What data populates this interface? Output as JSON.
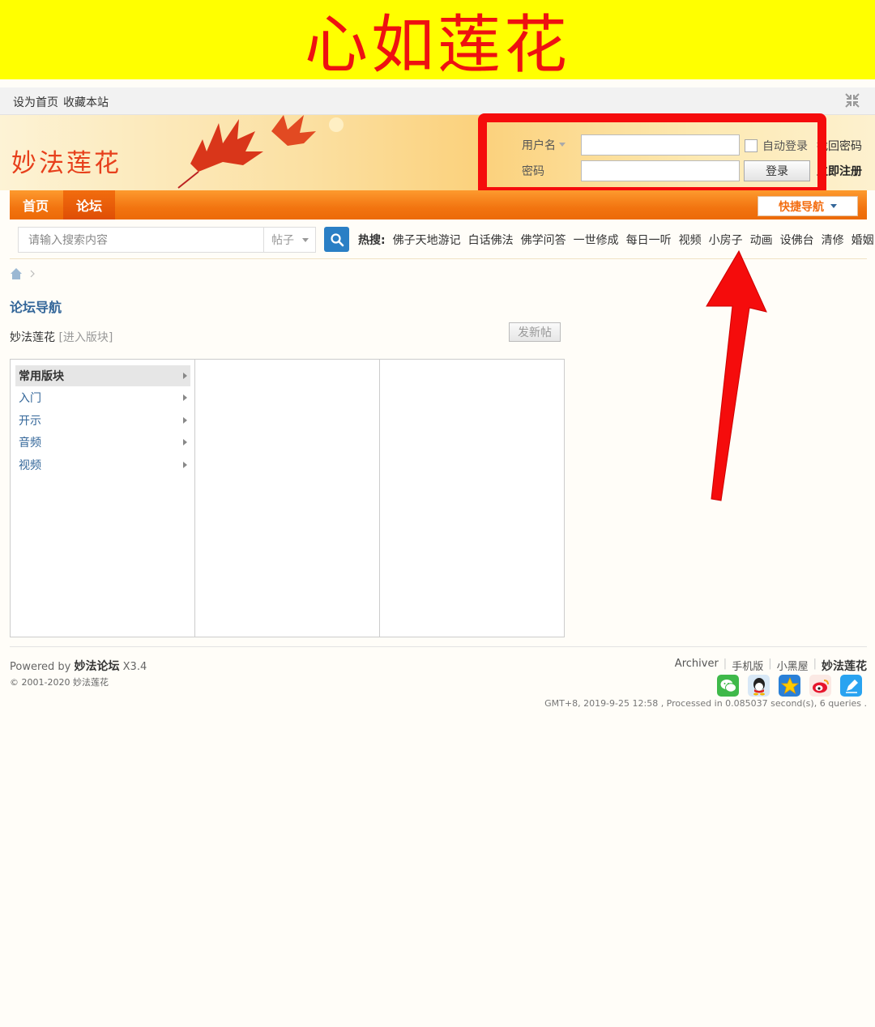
{
  "banner": {
    "title": "心如莲花"
  },
  "topbar": {
    "set_home": "设为首页",
    "bookmark": "收藏本站"
  },
  "header": {
    "logo": "妙法莲花"
  },
  "login": {
    "username_label": "用户名",
    "password_label": "密码",
    "auto_login": "自动登录",
    "login_button": "登录",
    "find_password": "找回密码",
    "register": "立即注册"
  },
  "nav": {
    "home": "首页",
    "forum": "论坛",
    "quick_nav": "快捷导航"
  },
  "search": {
    "placeholder": "请输入搜索内容",
    "type": "帖子",
    "hot_label": "热搜:",
    "hot_terms": [
      "佛子天地游记",
      "白话佛法",
      "佛学问答",
      "一世修成",
      "每日一听",
      "视频",
      "小房子",
      "动画",
      "设佛台",
      "清修",
      "婚姻"
    ]
  },
  "page": {
    "title": "论坛导航",
    "forum_name": "妙法莲花",
    "enter_board": "[进入版块]",
    "new_post": "发新帖"
  },
  "menu": [
    "常用版块",
    "入门",
    "开示",
    "音频",
    "视频"
  ],
  "footer": {
    "powered_by": "Powered by",
    "powered_name": "妙法论坛",
    "version": "X3.4",
    "copyright": "© 2001-2020 妙法莲花",
    "links": [
      "Archiver",
      "手机版",
      "小黑屋",
      "妙法莲花"
    ],
    "gmt": "GMT+8, 2019-9-25 12:58 , Processed in 0.085037 second(s), 6 queries ."
  },
  "social_icons": [
    "wechat-icon",
    "qq-icon",
    "qzone-icon",
    "weibo-icon",
    "edit-icon"
  ],
  "colors": {
    "banner_bg": "#ffff00",
    "banner_text": "#ee1111",
    "nav": "#f27410",
    "annotation": "#f50c0c",
    "link": "#336699"
  }
}
